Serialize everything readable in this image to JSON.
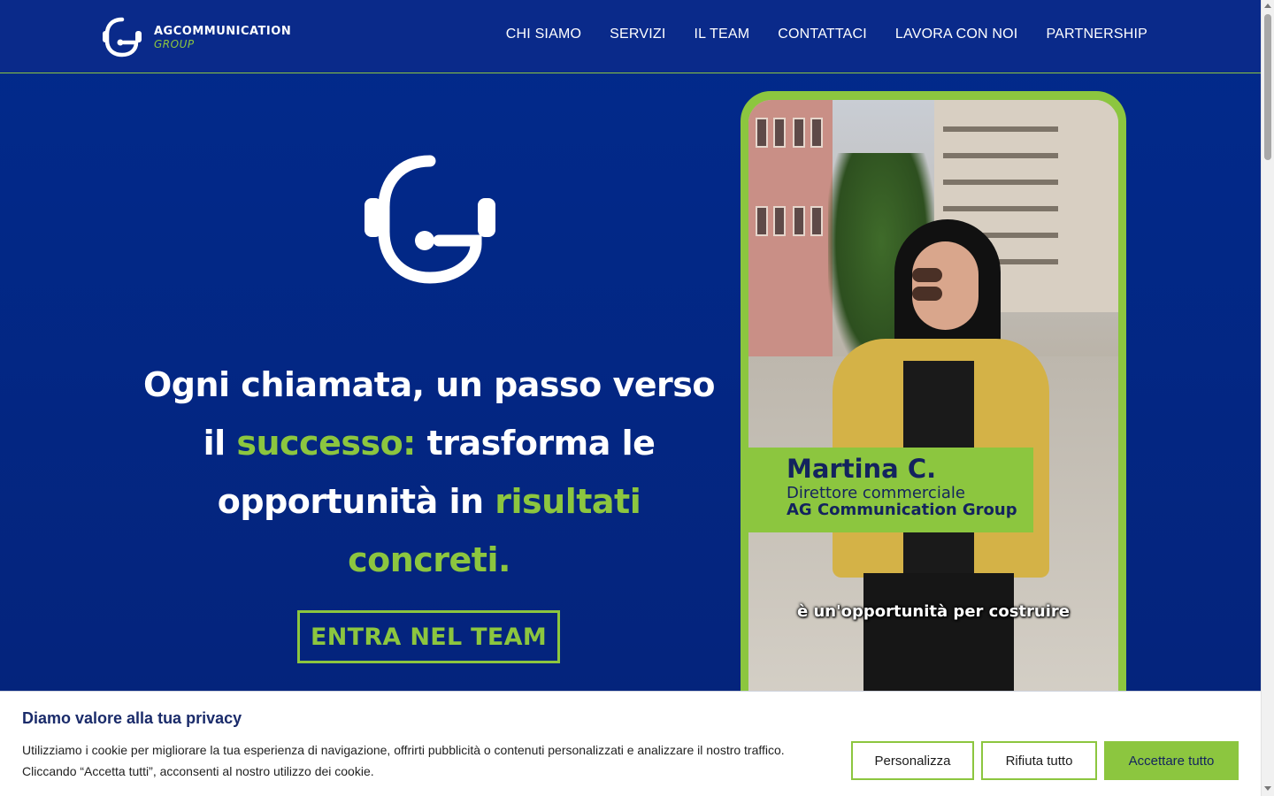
{
  "brand": {
    "name_line1": "AGCOMMUNICATION",
    "name_line2": "GROUP",
    "primary_color": "#0a2a8a",
    "accent_color": "#8cc63f"
  },
  "nav": {
    "items": [
      {
        "label": "CHI SIAMO"
      },
      {
        "label": "SERVIZI"
      },
      {
        "label": "IL TEAM"
      },
      {
        "label": "CONTATTACI"
      },
      {
        "label": "LAVORA CON NOI"
      },
      {
        "label": "PARTNERSHIP"
      }
    ]
  },
  "hero": {
    "icon": "headset-g-logo-icon",
    "headline_part1": "Ogni chiamata, un passo verso il ",
    "headline_green1": "successo:",
    "headline_part2": " trasforma le opportunità in ",
    "headline_green2": "risultati concreti.",
    "cta_label": "ENTRA NEL TEAM"
  },
  "video": {
    "name": "Martina C.",
    "role": "Direttore commerciale",
    "company": "AG Communication Group",
    "caption": "è un'opportunità per costruire"
  },
  "cookie_banner": {
    "title": "Diamo valore alla tua privacy",
    "text_line1": "Utilizziamo i cookie per migliorare la tua esperienza di navigazione, offrirti pubblicità o contenuti personalizzati e analizzare il nostro traffico.",
    "text_line2": "Cliccando “Accetta tutti”, acconsenti al nostro utilizzo dei cookie.",
    "customize_label": "Personalizza",
    "reject_label": "Rifiuta tutto",
    "accept_label": "Accettare tutto"
  }
}
